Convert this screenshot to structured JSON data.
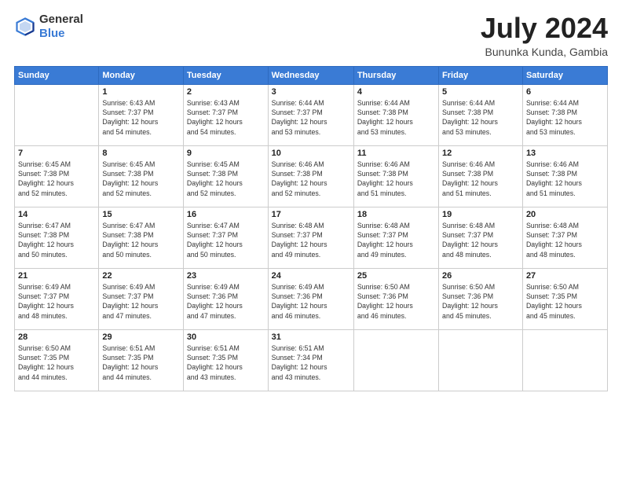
{
  "header": {
    "logo_general": "General",
    "logo_blue": "Blue",
    "title": "July 2024",
    "location": "Bununka Kunda, Gambia"
  },
  "calendar": {
    "headers": [
      "Sunday",
      "Monday",
      "Tuesday",
      "Wednesday",
      "Thursday",
      "Friday",
      "Saturday"
    ],
    "rows": [
      [
        {
          "day": "",
          "info": ""
        },
        {
          "day": "1",
          "info": "Sunrise: 6:43 AM\nSunset: 7:37 PM\nDaylight: 12 hours\nand 54 minutes."
        },
        {
          "day": "2",
          "info": "Sunrise: 6:43 AM\nSunset: 7:37 PM\nDaylight: 12 hours\nand 54 minutes."
        },
        {
          "day": "3",
          "info": "Sunrise: 6:44 AM\nSunset: 7:37 PM\nDaylight: 12 hours\nand 53 minutes."
        },
        {
          "day": "4",
          "info": "Sunrise: 6:44 AM\nSunset: 7:38 PM\nDaylight: 12 hours\nand 53 minutes."
        },
        {
          "day": "5",
          "info": "Sunrise: 6:44 AM\nSunset: 7:38 PM\nDaylight: 12 hours\nand 53 minutes."
        },
        {
          "day": "6",
          "info": "Sunrise: 6:44 AM\nSunset: 7:38 PM\nDaylight: 12 hours\nand 53 minutes."
        }
      ],
      [
        {
          "day": "7",
          "info": "Sunrise: 6:45 AM\nSunset: 7:38 PM\nDaylight: 12 hours\nand 52 minutes."
        },
        {
          "day": "8",
          "info": "Sunrise: 6:45 AM\nSunset: 7:38 PM\nDaylight: 12 hours\nand 52 minutes."
        },
        {
          "day": "9",
          "info": "Sunrise: 6:45 AM\nSunset: 7:38 PM\nDaylight: 12 hours\nand 52 minutes."
        },
        {
          "day": "10",
          "info": "Sunrise: 6:46 AM\nSunset: 7:38 PM\nDaylight: 12 hours\nand 52 minutes."
        },
        {
          "day": "11",
          "info": "Sunrise: 6:46 AM\nSunset: 7:38 PM\nDaylight: 12 hours\nand 51 minutes."
        },
        {
          "day": "12",
          "info": "Sunrise: 6:46 AM\nSunset: 7:38 PM\nDaylight: 12 hours\nand 51 minutes."
        },
        {
          "day": "13",
          "info": "Sunrise: 6:46 AM\nSunset: 7:38 PM\nDaylight: 12 hours\nand 51 minutes."
        }
      ],
      [
        {
          "day": "14",
          "info": "Sunrise: 6:47 AM\nSunset: 7:38 PM\nDaylight: 12 hours\nand 50 minutes."
        },
        {
          "day": "15",
          "info": "Sunrise: 6:47 AM\nSunset: 7:38 PM\nDaylight: 12 hours\nand 50 minutes."
        },
        {
          "day": "16",
          "info": "Sunrise: 6:47 AM\nSunset: 7:37 PM\nDaylight: 12 hours\nand 50 minutes."
        },
        {
          "day": "17",
          "info": "Sunrise: 6:48 AM\nSunset: 7:37 PM\nDaylight: 12 hours\nand 49 minutes."
        },
        {
          "day": "18",
          "info": "Sunrise: 6:48 AM\nSunset: 7:37 PM\nDaylight: 12 hours\nand 49 minutes."
        },
        {
          "day": "19",
          "info": "Sunrise: 6:48 AM\nSunset: 7:37 PM\nDaylight: 12 hours\nand 48 minutes."
        },
        {
          "day": "20",
          "info": "Sunrise: 6:48 AM\nSunset: 7:37 PM\nDaylight: 12 hours\nand 48 minutes."
        }
      ],
      [
        {
          "day": "21",
          "info": "Sunrise: 6:49 AM\nSunset: 7:37 PM\nDaylight: 12 hours\nand 48 minutes."
        },
        {
          "day": "22",
          "info": "Sunrise: 6:49 AM\nSunset: 7:37 PM\nDaylight: 12 hours\nand 47 minutes."
        },
        {
          "day": "23",
          "info": "Sunrise: 6:49 AM\nSunset: 7:36 PM\nDaylight: 12 hours\nand 47 minutes."
        },
        {
          "day": "24",
          "info": "Sunrise: 6:49 AM\nSunset: 7:36 PM\nDaylight: 12 hours\nand 46 minutes."
        },
        {
          "day": "25",
          "info": "Sunrise: 6:50 AM\nSunset: 7:36 PM\nDaylight: 12 hours\nand 46 minutes."
        },
        {
          "day": "26",
          "info": "Sunrise: 6:50 AM\nSunset: 7:36 PM\nDaylight: 12 hours\nand 45 minutes."
        },
        {
          "day": "27",
          "info": "Sunrise: 6:50 AM\nSunset: 7:35 PM\nDaylight: 12 hours\nand 45 minutes."
        }
      ],
      [
        {
          "day": "28",
          "info": "Sunrise: 6:50 AM\nSunset: 7:35 PM\nDaylight: 12 hours\nand 44 minutes."
        },
        {
          "day": "29",
          "info": "Sunrise: 6:51 AM\nSunset: 7:35 PM\nDaylight: 12 hours\nand 44 minutes."
        },
        {
          "day": "30",
          "info": "Sunrise: 6:51 AM\nSunset: 7:35 PM\nDaylight: 12 hours\nand 43 minutes."
        },
        {
          "day": "31",
          "info": "Sunrise: 6:51 AM\nSunset: 7:34 PM\nDaylight: 12 hours\nand 43 minutes."
        },
        {
          "day": "",
          "info": ""
        },
        {
          "day": "",
          "info": ""
        },
        {
          "day": "",
          "info": ""
        }
      ]
    ]
  }
}
